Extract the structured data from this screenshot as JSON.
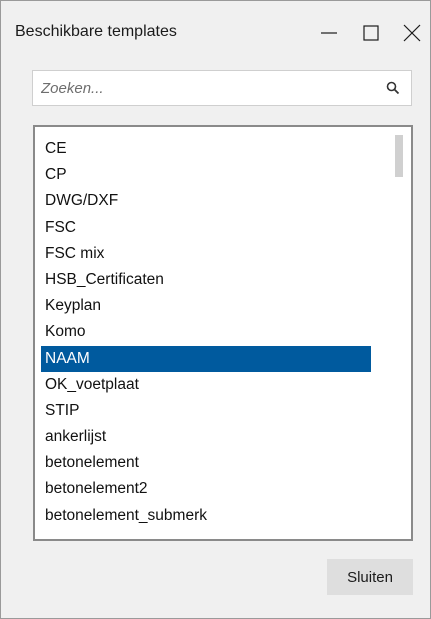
{
  "window": {
    "title": "Beschikbare templates",
    "controls": {
      "minimize_icon": "minimize-icon",
      "maximize_icon": "maximize-icon",
      "close_icon": "close-icon"
    }
  },
  "search": {
    "value": "",
    "placeholder": "Zoeken...",
    "icon": "search-icon"
  },
  "templates": {
    "selected_index": 8,
    "items": [
      "CE",
      "CP",
      "DWG/DXF",
      "FSC",
      "FSC mix",
      "HSB_Certificaten",
      "Keyplan",
      "Komo",
      "NAAM",
      "OK_voetplaat",
      "STIP",
      "ankerlijst",
      "betonelement",
      "betonelement2",
      "betonelement_submerk"
    ]
  },
  "footer": {
    "close_label": "Sluiten"
  },
  "colors": {
    "selection": "#005a9e",
    "window_bg": "#f0f0f0"
  }
}
